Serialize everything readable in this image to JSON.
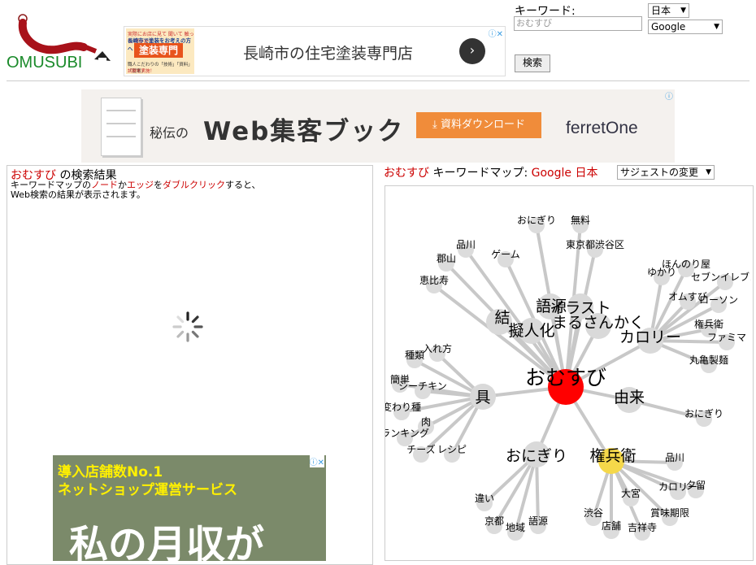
{
  "header": {
    "logo_text": "OMUSUBI",
    "keyword_label": "キーワード:",
    "keyword_placeholder": "おむすび",
    "country_select": "日本",
    "engine_select": "Google",
    "search_button": "検索"
  },
  "ads": {
    "top": {
      "thumb_line1": "実際にお店に見て 聞いて 触って 確かめて",
      "thumb_line2": "長崎市で塗装をお考えの方へ",
      "thumb_badge": "塗装専門",
      "thumb_line4": "職人こだわりの「技術」「資料」「提案」",
      "thumb_line5": "試験を実施！",
      "headline": "長崎市の住宅塗装専門店"
    },
    "middle": {
      "prefix": "秘伝の",
      "title": "Web集客ブック",
      "button": "資料ダウンロード",
      "brand": "ferretOne"
    },
    "left": {
      "line1": "導入店舗数No.1",
      "line2": "ネットショップ運営サービス",
      "line3": "私の月収が"
    }
  },
  "results": {
    "keyword": "おむすび",
    "title_suffix": " の検索結果",
    "help": {
      "p1": "キーワードマップの",
      "node": "ノード",
      "p2": "か",
      "edge": "エッジ",
      "p3": "を",
      "dbl": "ダブルクリック",
      "p4": "すると、",
      "line2": "Web検索の結果が表示されます。"
    }
  },
  "map": {
    "keyword": "おむすび",
    "title_label": " キーワードマップ: ",
    "engine": "Google",
    "country": "日本",
    "suggest_select": "サジェストの変更",
    "nodes": [
      {
        "id": "center",
        "label": "おむすび",
        "size": "large",
        "color": "#ff0000"
      },
      {
        "id": "musubi",
        "label": "結",
        "size": "medium",
        "color": "#d9d9d9"
      },
      {
        "id": "gogen",
        "label": "語源",
        "size": "medium",
        "color": "#d9d9d9"
      },
      {
        "id": "giji",
        "label": "擬人化",
        "size": "medium",
        "color": "#d9d9d9"
      },
      {
        "id": "illust",
        "label": "イラスト",
        "size": "medium",
        "color": "#d9d9d9"
      },
      {
        "id": "maru",
        "label": "まるさんかく",
        "size": "medium",
        "color": "#d9d9d9"
      },
      {
        "id": "calorie",
        "label": "カロリー",
        "size": "medium",
        "color": "#d9d9d9"
      },
      {
        "id": "gu",
        "label": "具",
        "size": "medium",
        "color": "#d9d9d9"
      },
      {
        "id": "yurai",
        "label": "由来",
        "size": "medium",
        "color": "#d9d9d9"
      },
      {
        "id": "onigiri",
        "label": "おにぎり",
        "size": "medium",
        "color": "#d9d9d9"
      },
      {
        "id": "gonbei",
        "label": "権兵衛",
        "size": "medium",
        "color": "#f5d84a"
      }
    ],
    "leaf_labels": {
      "top": [
        "おにぎり",
        "無料",
        "東京都渋谷区",
        "品川",
        "ゲーム",
        "郡山",
        "恵比寿"
      ],
      "calorie": [
        "ほんのり屋",
        "ゆかり",
        "セブンイレブン",
        "オムすび",
        "ローソン",
        "権兵衛",
        "ファミマ",
        "丸亀製麺"
      ],
      "yurai": [
        "おにぎり"
      ],
      "gu": [
        "入れ方",
        "種類",
        "簡単",
        "シーチキン",
        "変わり種",
        "肉",
        "ランキング",
        "チーズ",
        "レシピ"
      ],
      "onigiri": [
        "違い",
        "京都",
        "地域",
        "語源"
      ],
      "gonbei": [
        "品川",
        "カロリー",
        "夕留",
        "賞味期限",
        "大宮",
        "渋谷",
        "店舗",
        "吉祥寺"
      ]
    }
  }
}
